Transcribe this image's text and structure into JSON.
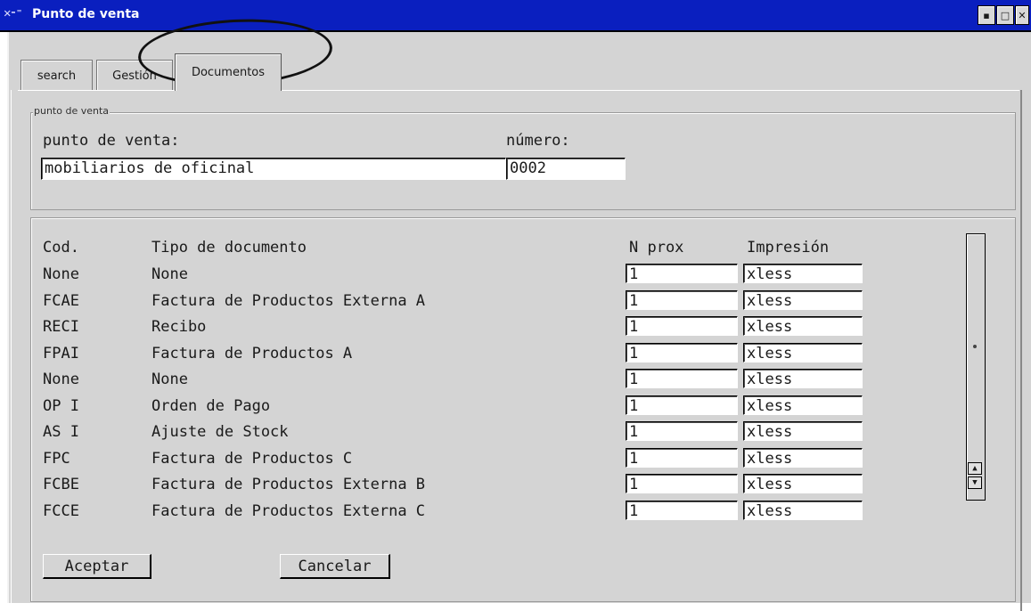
{
  "window": {
    "title": "Punto de venta",
    "app_icon": "x-window-icon"
  },
  "tabs": [
    {
      "label": "search"
    },
    {
      "label": "Gestión"
    },
    {
      "label": "Documentos"
    }
  ],
  "group1": {
    "legend": "punto de venta",
    "pv_label": "punto de venta:",
    "pv_value": "mobiliarios de oficinal",
    "num_label": "número:",
    "num_value": "0002"
  },
  "table": {
    "headers": {
      "cod": "Cod.",
      "tipo": "Tipo de documento",
      "nprox": "N prox",
      "impresion": "Impresión"
    },
    "rows": [
      {
        "cod": "None",
        "tipo": "None",
        "nprox": "1",
        "impresion": "xless"
      },
      {
        "cod": "FCAE",
        "tipo": "Factura de Productos Externa A",
        "nprox": "1",
        "impresion": "xless"
      },
      {
        "cod": "RECI",
        "tipo": "Recibo",
        "nprox": "1",
        "impresion": "xless"
      },
      {
        "cod": "FPAI",
        "tipo": "Factura de Productos A",
        "nprox": "1",
        "impresion": "xless"
      },
      {
        "cod": "None",
        "tipo": "None",
        "nprox": "1",
        "impresion": "xless"
      },
      {
        "cod": "OP I",
        "tipo": "Orden de Pago",
        "nprox": "1",
        "impresion": "xless"
      },
      {
        "cod": "AS I",
        "tipo": "Ajuste de Stock",
        "nprox": "1",
        "impresion": "xless"
      },
      {
        "cod": "FPC",
        "tipo": "Factura de Productos C",
        "nprox": "1",
        "impresion": "xless"
      },
      {
        "cod": "FCBE",
        "tipo": "Factura de Productos Externa B",
        "nprox": "1",
        "impresion": "xless"
      },
      {
        "cod": "FCCE",
        "tipo": "Factura de Productos Externa C",
        "nprox": "1",
        "impresion": "xless"
      }
    ]
  },
  "buttons": {
    "accept": "Aceptar",
    "cancel": "Cancelar"
  },
  "colors": {
    "titlebar": "#0a1fbf",
    "panel": "#d4d4d4"
  }
}
